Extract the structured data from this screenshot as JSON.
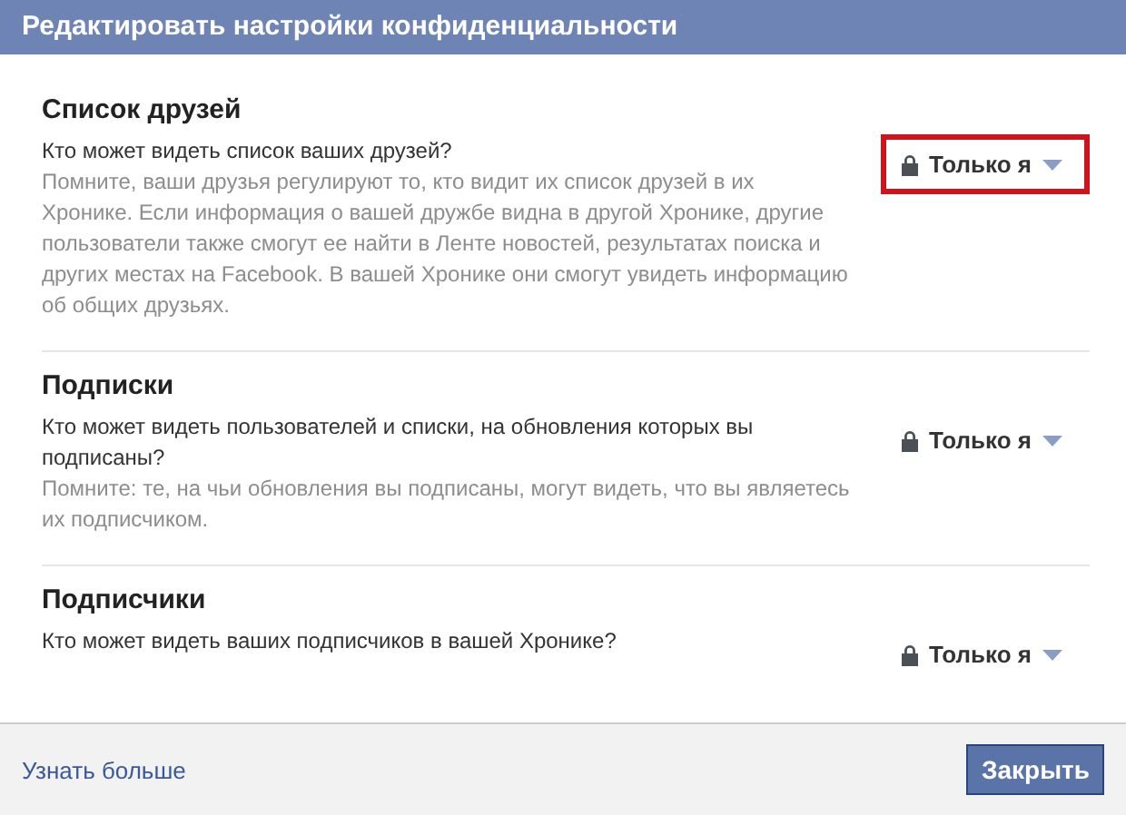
{
  "window": {
    "title": "Редактировать настройки конфиденциальности"
  },
  "sections": [
    {
      "heading": "Список друзей",
      "question": "Кто может видеть список ваших друзей?",
      "note": "Помните, ваши друзья регулируют то, кто видит их список друзей в их Хронике. Если информация о вашей дружбе видна в другой Хронике, другие пользователи также смогут ее найти в Ленте новостей, результатах поиска и других местах на Facebook. В вашей Хронике они смогут увидеть информацию об общих друзьях.",
      "audience": "Только я",
      "highlighted": true
    },
    {
      "heading": "Подписки",
      "question": "Кто может видеть пользователей и списки, на обновления которых вы подписаны?",
      "note": "Помните: те, на чьи обновления вы подписаны, могут видеть, что вы являетесь их подписчиком.",
      "audience": "Только я",
      "highlighted": false
    },
    {
      "heading": "Подписчики",
      "question": "Кто может видеть ваших подписчиков в вашей Хронике?",
      "audience": "Только я",
      "highlighted": false
    }
  ],
  "footer": {
    "link": "Узнать больше",
    "button": "Закрыть"
  }
}
